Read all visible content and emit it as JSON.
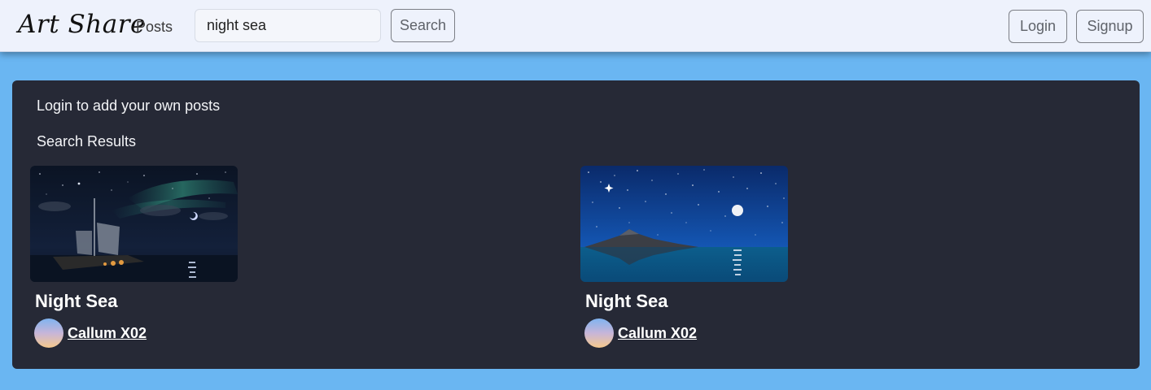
{
  "navbar": {
    "brand": "Art Share",
    "posts_link": "Posts",
    "search": {
      "value": "night sea",
      "placeholder": ""
    },
    "search_button": "Search",
    "login_button": "Login",
    "signup_button": "Signup"
  },
  "panel": {
    "login_hint": "Login to add your own posts",
    "results_heading": "Search Results",
    "results": [
      {
        "title": "Night Sea",
        "author": "Callum X02",
        "thumbnail": "pirate-ship-night-sea-image"
      },
      {
        "title": "Night Sea",
        "author": "Callum X02",
        "thumbnail": "moonlit-island-sea-image"
      }
    ]
  },
  "colors": {
    "page_background": "#6ab6f2",
    "navbar_background": "#eef2fc",
    "panel_background": "#262936",
    "text_light": "#ffffff"
  }
}
